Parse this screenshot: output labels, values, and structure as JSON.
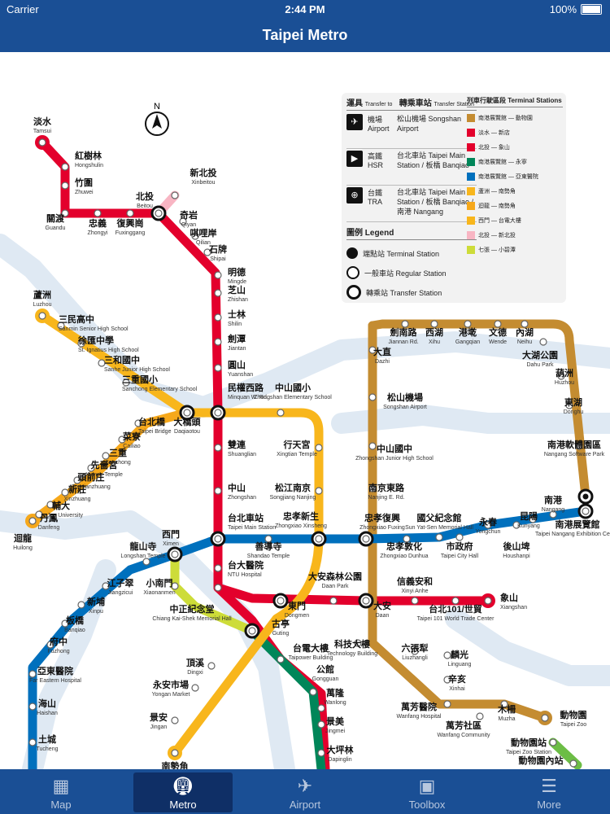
{
  "status_bar": {
    "carrier": "Carrier",
    "time": "2:44 PM",
    "battery": "100%"
  },
  "nav_bar": {
    "title": "Taipei Metro"
  },
  "colors": {
    "red": "#e3002c",
    "pink": "#f8b5c3",
    "orange": "#f6a81b",
    "yellow": "#f8b61c",
    "brown": "#c48c31",
    "blue": "#0070bd",
    "green": "#008659",
    "lime": "#cddc39",
    "water": "#dfe9f3"
  },
  "compass": {
    "label": "N"
  },
  "legend": {
    "transfer_header": "運具",
    "transfer_header_en": "Transfer to",
    "station_header": "轉乘車站",
    "station_header_en": "Transfer Station",
    "rows": [
      {
        "icon": "✈",
        "zh": "機場",
        "en": "Airport",
        "value": "松山機場 Songshan Airport"
      },
      {
        "icon": "▶",
        "zh": "高鐵",
        "en": "HSR",
        "value": "台北車站 Taipei Main Station / 板橋 Banqiao"
      },
      {
        "icon": "⊕",
        "zh": "台鐵",
        "en": "TRA",
        "value": "台北車站 Taipei Main Station / 板橋 Banqiao / 南港 Nangang"
      }
    ],
    "symbols_header": "圖例 Legend",
    "symbols": [
      {
        "type": "term",
        "label": "端點站 Terminal Station"
      },
      {
        "type": "reg",
        "label": "一般車站 Regular Station"
      },
      {
        "type": "trans",
        "label": "轉乘站 Transfer Station"
      }
    ],
    "sections_header": "列車行駛區段 Terminal Stations",
    "sections": [
      {
        "color": "#c48c31",
        "from": "南港展覽館",
        "to": "動物園"
      },
      {
        "color": "#e3002c",
        "from": "淡水",
        "to": "新店"
      },
      {
        "color": "#e3002c",
        "from": "北投",
        "to": "象山"
      },
      {
        "color": "#008659",
        "from": "南港展覽館",
        "to": "永寧"
      },
      {
        "color": "#0070bd",
        "from": "南港展覽館",
        "to": "亞東醫院"
      },
      {
        "color": "#f8b61c",
        "from": "蘆洲",
        "to": "南勢角"
      },
      {
        "color": "#f6a81b",
        "from": "迴龍",
        "to": "南勢角"
      },
      {
        "color": "#f8b61c",
        "from": "西門",
        "to": "台電大樓"
      },
      {
        "color": "#f8b5c3",
        "from": "北投",
        "to": "新北投"
      },
      {
        "color": "#cddc39",
        "from": "七張",
        "to": "小碧潭"
      }
    ]
  },
  "stations": [
    {
      "zh": "淡水",
      "en": "Tamsui"
    },
    {
      "zh": "紅樹林",
      "en": "Hongshulin"
    },
    {
      "zh": "竹圍",
      "en": "Zhuwei"
    },
    {
      "zh": "關渡",
      "en": "Guandu"
    },
    {
      "zh": "忠義",
      "en": "Zhongyi"
    },
    {
      "zh": "復興崗",
      "en": "Fuxinggang"
    },
    {
      "zh": "北投",
      "en": "Beitou"
    },
    {
      "zh": "新北投",
      "en": "Xinbeitou"
    },
    {
      "zh": "奇岩",
      "en": "Qiyan"
    },
    {
      "zh": "唭哩岸",
      "en": "Qilian"
    },
    {
      "zh": "石牌",
      "en": "Shipai"
    },
    {
      "zh": "明德",
      "en": "Mingde"
    },
    {
      "zh": "芝山",
      "en": "Zhishan"
    },
    {
      "zh": "士林",
      "en": "Shilin"
    },
    {
      "zh": "劍潭",
      "en": "Jiantan"
    },
    {
      "zh": "圓山",
      "en": "Yuanshan"
    },
    {
      "zh": "民權西路",
      "en": "Minquan W. Rd."
    },
    {
      "zh": "雙連",
      "en": "Shuanglian"
    },
    {
      "zh": "中山",
      "en": "Zhongshan"
    },
    {
      "zh": "台北車站",
      "en": "Taipei Main Station"
    },
    {
      "zh": "台大醫院",
      "en": "NTU Hospital"
    },
    {
      "zh": "中正紀念堂",
      "en": "Chiang Kai-Shek Memorial Hall"
    },
    {
      "zh": "東門",
      "en": "Dongmen"
    },
    {
      "zh": "大安森林公園",
      "en": "Daan Park"
    },
    {
      "zh": "大安",
      "en": "Daan"
    },
    {
      "zh": "信義安和",
      "en": "Xinyi Anhe"
    },
    {
      "zh": "台北101/世貿",
      "en": "Taipei 101 World Trade Center"
    },
    {
      "zh": "象山",
      "en": "Xiangshan"
    },
    {
      "zh": "蘆洲",
      "en": "Luzhou"
    },
    {
      "zh": "三民高中",
      "en": "Sanmin Senior High School"
    },
    {
      "zh": "徐匯中學",
      "en": "St. Ignatius High School"
    },
    {
      "zh": "三和國中",
      "en": "Sanhe Junior High School"
    },
    {
      "zh": "三重國小",
      "en": "Sanchong Elementary School"
    },
    {
      "zh": "台北橋",
      "en": "Taipei Bridge"
    },
    {
      "zh": "大橋頭",
      "en": "Daqiaotou"
    },
    {
      "zh": "中山國小",
      "en": "Zhongshan Elementary School"
    },
    {
      "zh": "行天宮",
      "en": "Xingtian Temple"
    },
    {
      "zh": "松江南京",
      "en": "Songjiang Nanjing"
    },
    {
      "zh": "忠孝新生",
      "en": "Zhongxiao Xinsheng"
    },
    {
      "zh": "古亭",
      "en": "Guting"
    },
    {
      "zh": "頂溪",
      "en": "Dingxi"
    },
    {
      "zh": "永安市場",
      "en": "Yongan Market"
    },
    {
      "zh": "景安",
      "en": "Jingan"
    },
    {
      "zh": "南勢角",
      "en": ""
    },
    {
      "zh": "菜寮",
      "en": "Cailiao"
    },
    {
      "zh": "三重",
      "en": "Sanchong"
    },
    {
      "zh": "先嗇宮",
      "en": "Xianse Temple"
    },
    {
      "zh": "頭前庄",
      "en": "Touqianzhuang"
    },
    {
      "zh": "新莊",
      "en": "Xinzhuang"
    },
    {
      "zh": "輔大",
      "en": "Fu Jen University"
    },
    {
      "zh": "丹鳳",
      "en": "Danfeng"
    },
    {
      "zh": "迴龍",
      "en": "Huilong"
    },
    {
      "zh": "西門",
      "en": "Ximen"
    },
    {
      "zh": "龍山寺",
      "en": "Longshan Temple"
    },
    {
      "zh": "江子翠",
      "en": "Jiangzicui"
    },
    {
      "zh": "新埔",
      "en": "Xinpu"
    },
    {
      "zh": "板橋",
      "en": "Banqiao"
    },
    {
      "zh": "府中",
      "en": "Fuzhong"
    },
    {
      "zh": "亞東醫院",
      "en": "Far Eastern Hospital"
    },
    {
      "zh": "海山",
      "en": "Haishan"
    },
    {
      "zh": "土城",
      "en": "Tucheng"
    },
    {
      "zh": "小南門",
      "en": "Xiaonanmen"
    },
    {
      "zh": "善導寺",
      "en": "Shandao Temple"
    },
    {
      "zh": "忠孝復興",
      "en": "Zhongxiao Fuxing"
    },
    {
      "zh": "忠孝敦化",
      "en": "Zhongxiao Dunhua"
    },
    {
      "zh": "國父紀念館",
      "en": "Sun Yat-Sen Memorial Hall"
    },
    {
      "zh": "市政府",
      "en": "Taipei City Hall"
    },
    {
      "zh": "永春",
      "en": "Yongchun"
    },
    {
      "zh": "後山埤",
      "en": "Houshanpi"
    },
    {
      "zh": "昆陽",
      "en": "Kunyang"
    },
    {
      "zh": "南港",
      "en": "Nangang"
    },
    {
      "zh": "南港展覽館",
      "en": "Taipei Nangang Exhibition Center"
    },
    {
      "zh": "台電大樓",
      "en": "Taipower Building"
    },
    {
      "zh": "公館",
      "en": "Gongguan"
    },
    {
      "zh": "萬隆",
      "en": "Wanlong"
    },
    {
      "zh": "景美",
      "en": "Jingmei"
    },
    {
      "zh": "大坪林",
      "en": "Dapinglin"
    },
    {
      "zh": "劍南路",
      "en": "Jiannan Rd."
    },
    {
      "zh": "西湖",
      "en": "Xihu"
    },
    {
      "zh": "港墘",
      "en": "Gangqian"
    },
    {
      "zh": "文德",
      "en": "Wende"
    },
    {
      "zh": "內湖",
      "en": "Neihu"
    },
    {
      "zh": "大湖公園",
      "en": "Dahu Park"
    },
    {
      "zh": "葫洲",
      "en": "Huzhou"
    },
    {
      "zh": "東湖",
      "en": "Donghu"
    },
    {
      "zh": "南港軟體園區",
      "en": "Nangang Software Park"
    },
    {
      "zh": "大直",
      "en": "Dazhi"
    },
    {
      "zh": "松山機場",
      "en": "Songshan Airport"
    },
    {
      "zh": "中山國中",
      "en": "Zhongshan Junior High School"
    },
    {
      "zh": "南京東路",
      "en": "Nanjing E. Rd."
    },
    {
      "zh": "科技大樓",
      "en": "Technology Building"
    },
    {
      "zh": "六張犁",
      "en": "Liuzhangli"
    },
    {
      "zh": "麟光",
      "en": "Linguang"
    },
    {
      "zh": "辛亥",
      "en": "Xinhai"
    },
    {
      "zh": "萬芳醫院",
      "en": "Wanfang Hospital"
    },
    {
      "zh": "萬芳社區",
      "en": "Wanfang Community"
    },
    {
      "zh": "木柵",
      "en": "Muzha"
    },
    {
      "zh": "動物園",
      "en": "Taipei Zoo"
    },
    {
      "zh": "動物園站",
      "en": "Taipei Zoo Station"
    },
    {
      "zh": "動物園內站",
      "en": ""
    }
  ],
  "tabs": [
    {
      "label": "Map",
      "icon": "map-icon",
      "active": false
    },
    {
      "label": "Metro",
      "icon": "train-icon",
      "active": true
    },
    {
      "label": "Airport",
      "icon": "airplane-icon",
      "active": false
    },
    {
      "label": "Toolbox",
      "icon": "toolbox-icon",
      "active": false
    },
    {
      "label": "More",
      "icon": "list-icon",
      "active": false
    }
  ]
}
